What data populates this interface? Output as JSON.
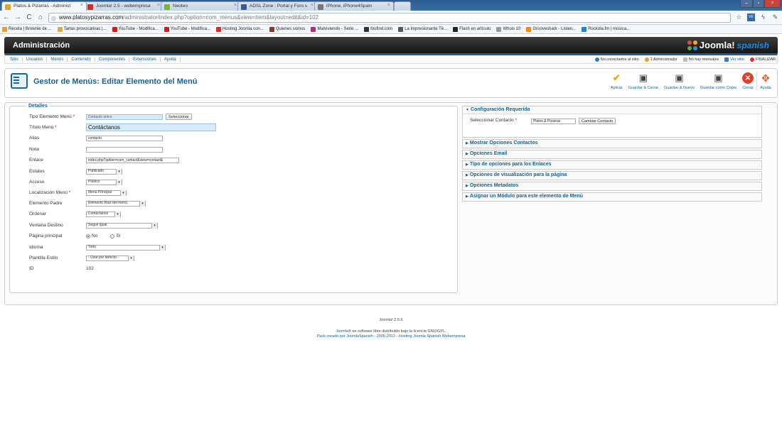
{
  "browser": {
    "tabs": [
      {
        "title": "Platos & Pizarras - Administ",
        "color": "#e7a12b",
        "active": true
      },
      {
        "title": "Joomla! 2.5 - webempresa",
        "color": "#c9302c",
        "active": false
      },
      {
        "title": "Neoteo",
        "color": "#7bb33d",
        "active": false
      },
      {
        "title": "ADSL Zone : Portal y Foro s",
        "color": "#3b5b8c",
        "active": false
      },
      {
        "title": "iPhone, iPhone4Spain",
        "color": "#777777",
        "active": false
      }
    ],
    "url_host": "www.platosypizarras.com",
    "url_path": "/administrator/index.php?option=com_menus&view=item&layout=edit&id=102",
    "bookmarks": [
      {
        "label": "Receta | Brownie de ...",
        "color": "#e7a12b"
      },
      {
        "label": "Tartas provocativas |...",
        "color": "#d9a94b"
      },
      {
        "label": "YouTube - Modifica...",
        "color": "#cc1f1f"
      },
      {
        "label": "YouTube - Modifica...",
        "color": "#cc1f1f"
      },
      {
        "label": "Hosting Joomla con...",
        "color": "#c9302c"
      },
      {
        "label": "Quienes somos",
        "color": "#8b3a1a"
      },
      {
        "label": "Malviviendo - Serie ...",
        "color": "#b52a84"
      },
      {
        "label": "foofind.com",
        "color": "#333333"
      },
      {
        "label": "La Impresionante Té...",
        "color": "#555555"
      },
      {
        "label": "Flash en artículo",
        "color": "#222222"
      },
      {
        "label": "Whois 10",
        "color": "#999999"
      },
      {
        "label": "Grooveshark - Listen...",
        "color": "#f18a1f"
      },
      {
        "label": "Rockola.fm | música...",
        "color": "#2a7ccc"
      }
    ]
  },
  "header": {
    "admin_label": "Administración",
    "logo_word": "Joomla!",
    "logo_spanish": "spanish"
  },
  "menubar": {
    "items": [
      "Sitio",
      "Usuarios",
      "Menús",
      "Contenido",
      "Componentes",
      "Extensiones",
      "Ayuda"
    ],
    "status": {
      "visitors": "No conectados al sitio",
      "admins": "1 Administrador",
      "messages": "No hay mensajes",
      "view_site": "Ver sitio",
      "logout": "FINALIZAR"
    }
  },
  "toolbar": {
    "title": "Gestor de Menús: Editar Elemento del Menú",
    "buttons": {
      "apply": "Aplicar",
      "save_close": "Guardar & Cerrar",
      "save_new": "Guardar & Nuevo",
      "save_copy": "Guardar como Copia",
      "close": "Cerrar",
      "help": "Ayuda"
    }
  },
  "details": {
    "legend": "Detalles",
    "type_label": "Tipo Elemento Menú",
    "type_value": "Contacto único",
    "select_button": "Seleccionar",
    "title_label": "Título Menú",
    "title_value": "Contáctanos",
    "alias_label": "Alias",
    "alias_value": "contacto",
    "note_label": "Nota",
    "note_value": "",
    "link_label": "Enlace",
    "link_value": "index.php?option=com_contact&view=contact&",
    "status_label": "Estatus",
    "status_value": "Publicado",
    "access_label": "Acceso",
    "access_value": "Público",
    "location_label": "Localización Menú",
    "location_value": "Menú Principal",
    "parent_label": "Elemento Padre",
    "parent_value": "Elemento Raíz del menú",
    "order_label": "Ordenar",
    "order_value": "Contáctanos",
    "target_label": "Ventana Destino",
    "target_value": "Seguir igual",
    "home_label": "Página principal",
    "home_no": "No",
    "home_yes": "Sí",
    "language_label": "Idioma",
    "language_value": "Todo",
    "template_label": "Plantilla Estilo",
    "template_value": "- Usar por defecto -",
    "id_label": "ID",
    "id_value": "102"
  },
  "required": {
    "title": "Configuración Requerida",
    "contact_label": "Seleccionar Contacto",
    "contact_value": "Platos & Pizarras",
    "change_button": "Cambiar Contacto"
  },
  "panels": [
    "Mostrar Opciones Contactos",
    "Opciones Email",
    "Tipo de opciones para los Enlaces",
    "Opciones de visualización para la página",
    "Opciones Metadatos",
    "Asignar un Módulo para este elemento de Menú"
  ],
  "footer": {
    "version": "Joomla! 2.5.6",
    "license_link": "Joomla®",
    "license_text": " es software libre distribuido bajo la licencia GNU/GPL.",
    "pack": "Pack creado por JoomlaSpanish - 2005-2012 - Hosting Joomla Spanish Webempresa"
  }
}
